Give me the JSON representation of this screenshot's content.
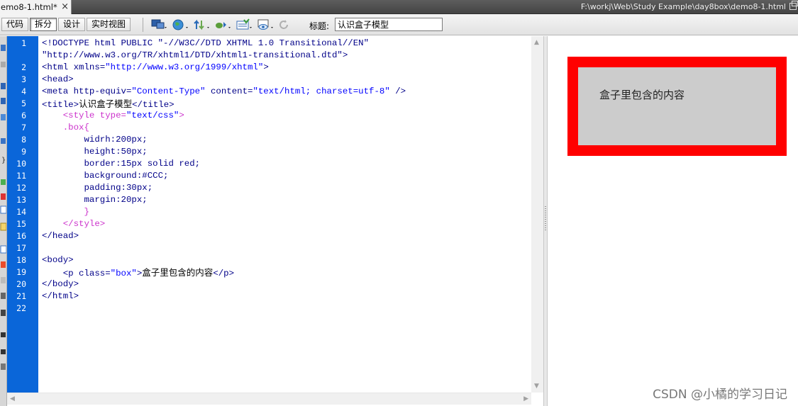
{
  "tab": {
    "label": "emo8-1.html*",
    "close": "×"
  },
  "file_path": "F:\\workj\\Web\\Study Example\\day8box\\demo8-1.html",
  "toolbar": {
    "view_buttons": [
      "代码",
      "拆分",
      "设计",
      "实时视图"
    ],
    "active_view": "拆分",
    "icons": [
      "multiscreen-icon",
      "globe-preview-icon",
      "file-transfer-icon",
      "debug-browser-icon",
      "visual-aids-icon",
      "view-options-icon",
      "refresh-icon"
    ],
    "title_label": "标题:",
    "title_value": "认识盒子模型"
  },
  "editor": {
    "line_numbers": [
      "1",
      "2",
      "3",
      "4",
      "5",
      "6",
      "7",
      "8",
      "9",
      "10",
      "11",
      "12",
      "13",
      "14",
      "15",
      "16",
      "17",
      "18",
      "19",
      "20",
      "21",
      "22"
    ],
    "colors": {
      "gutter": "#0a66d9",
      "tag": "#000088",
      "string": "#0000ff",
      "css": "#cc33cc"
    }
  },
  "code": {
    "l1a": "<!DOCTYPE html PUBLIC \"-//W3C//DTD XHTML 1.0 Transitional//EN\"",
    "l1b": "\"http://www.w3.org/TR/xhtml1/DTD/xhtml1-transitional.dtd\">",
    "l2_tag": "<html xmlns=",
    "l2_str": "\"http://www.w3.org/1999/xhtml\"",
    "l2_end": ">",
    "l3": "<head>",
    "l4_tag": "<meta http-equiv=",
    "l4_s1": "\"Content-Type\"",
    "l4_mid": " content=",
    "l4_s2": "\"text/html; charset=utf-8\"",
    "l4_end": " />",
    "l5_open": "<title>",
    "l5_text": "认识盒子模型",
    "l5_close": "</title>",
    "l6_tag": "<style type=",
    "l6_str": "\"text/css\"",
    "l6_end": ">",
    "l7": ".box{",
    "l8": "widrh:200px;",
    "l9": "height:50px;",
    "l10": "border:15px solid red;",
    "l11": "background:#CCC;",
    "l12": "padding:30px;",
    "l13": "margin:20px;",
    "l14": "}",
    "l15": "</style>",
    "l16": "</head>",
    "l18": "<body>",
    "l19_tag": "<p class=",
    "l19_str": "\"box\"",
    "l19_end": ">",
    "l19_text": "盒子里包含的内容",
    "l19_close": "</p>",
    "l20": "</body>",
    "l21": "</html>"
  },
  "design_view": {
    "box_text": "盒子里包含的内容",
    "box_background": "#CCC",
    "box_border_color": "#ff0000"
  },
  "watermark": "CSDN @小橘的学习日记"
}
